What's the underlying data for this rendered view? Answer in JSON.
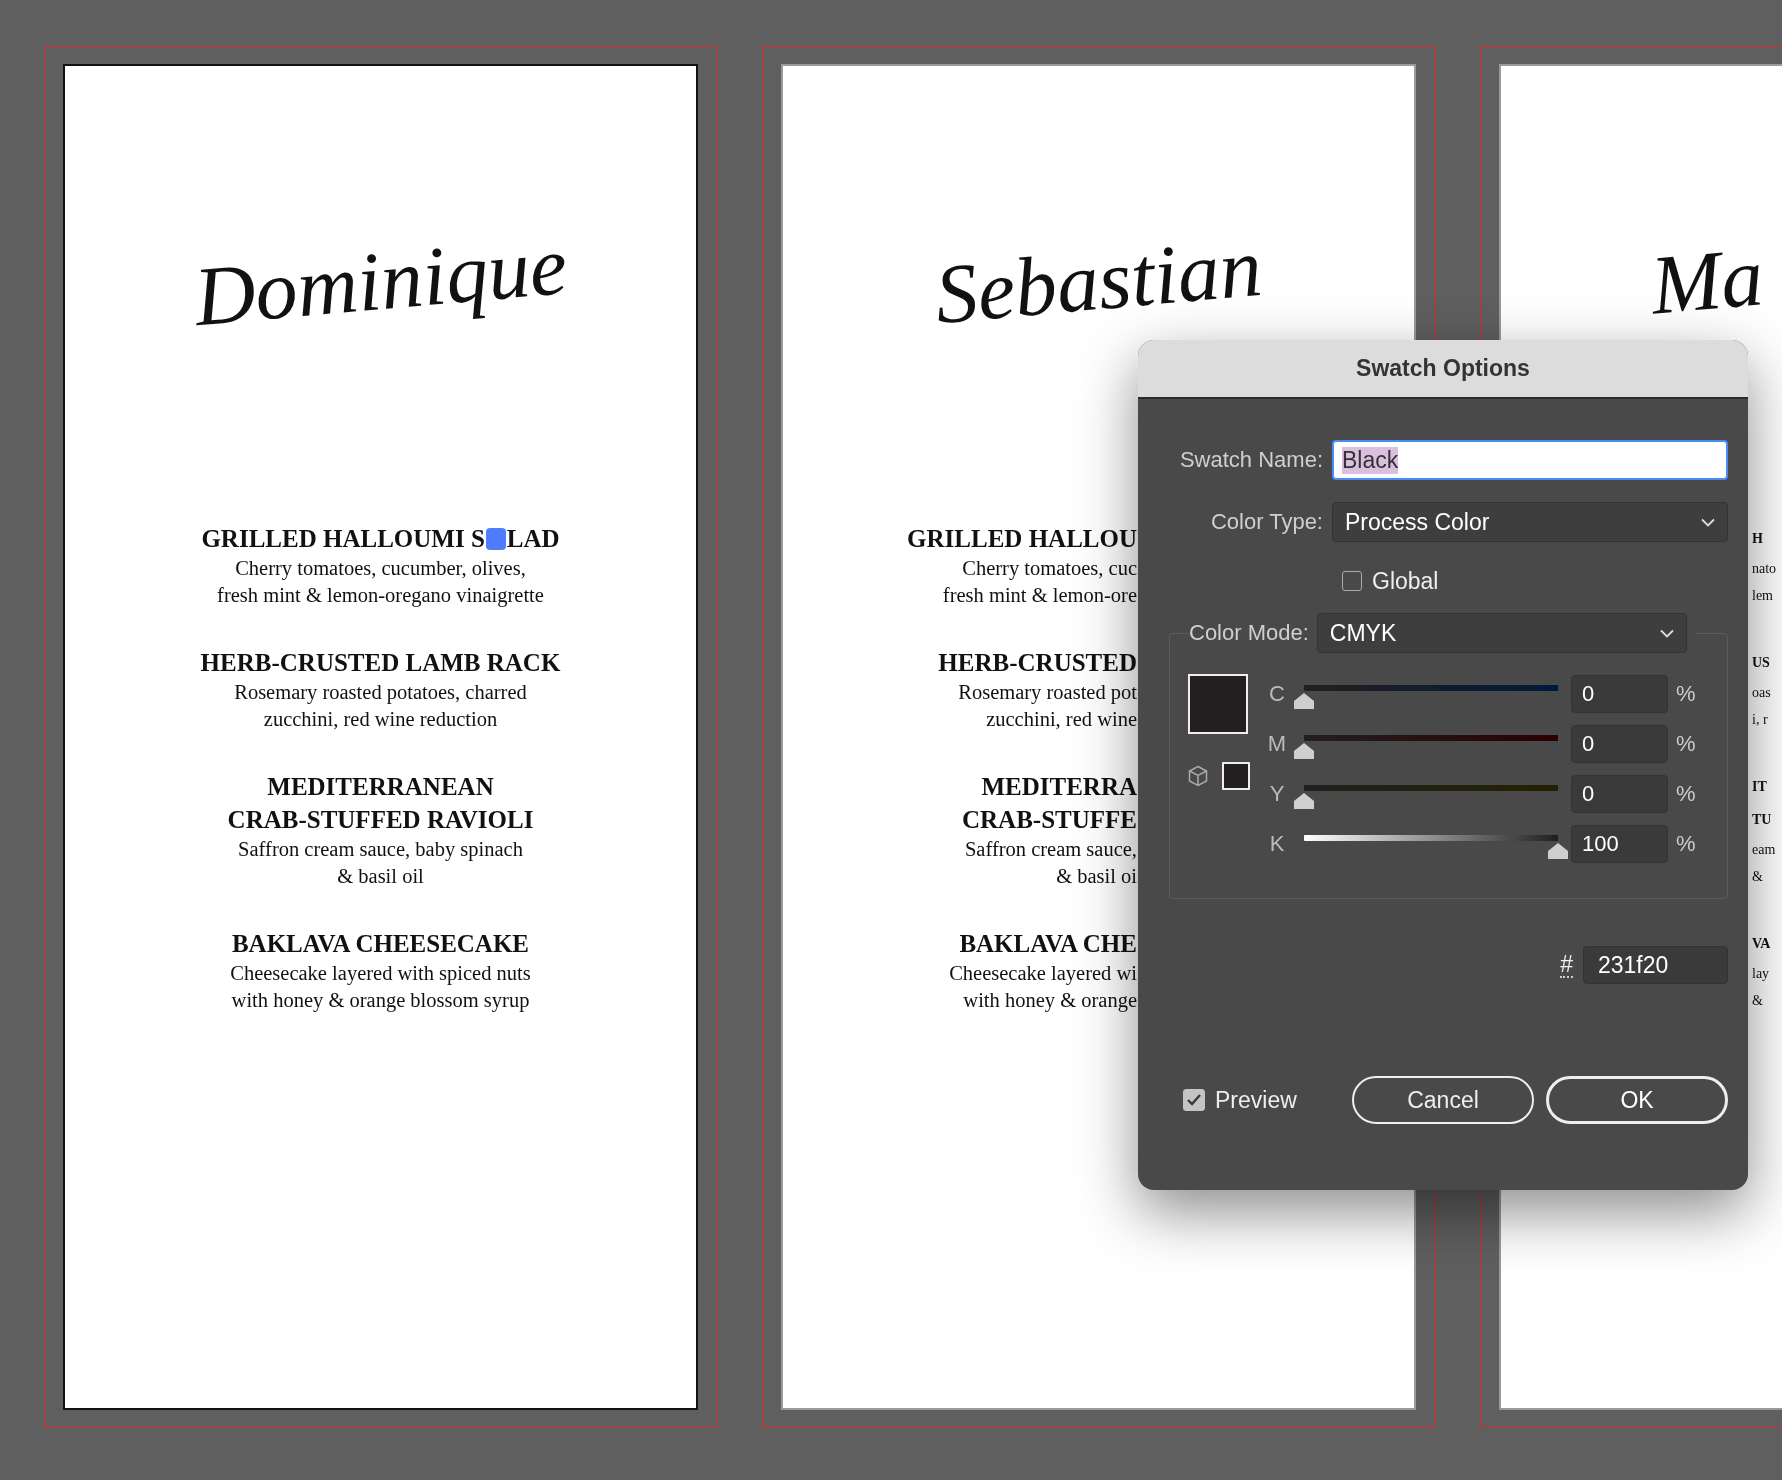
{
  "canvas": {
    "cards": [
      {
        "kind": "full",
        "selected": true,
        "title": "Dominique",
        "items": [
          {
            "heading": [
              "GRILLED HALLOUMI S",
              "LAD"
            ],
            "description": [
              "Cherry tomatoes, cucumber, olives,",
              "fresh mint & lemon-oregano vinaigrette"
            ],
            "text_cursor": true
          },
          {
            "heading": [
              "HERB-CRUSTED LAMB RACK"
            ],
            "description": [
              "Rosemary roasted potatoes, charred",
              "zucchini, red wine reduction"
            ],
            "text_cursor": false
          },
          {
            "heading": [
              "MEDITERRANEAN",
              "CRAB-STUFFED RAVIOLI"
            ],
            "description": [
              "Saffron cream sauce, baby spinach",
              "& basil oil"
            ],
            "text_cursor": false
          },
          {
            "heading": [
              "BAKLAVA CHEESECAKE"
            ],
            "description": [
              "Cheesecake layered with spiced nuts",
              "with honey & orange blossom syrup"
            ],
            "text_cursor": false
          }
        ]
      },
      {
        "kind": "right_hidden",
        "selected": false,
        "title": "Sebastian",
        "items": [
          {
            "heading": [
              "GRILLED HALLOU"
            ],
            "description": [
              "Cherry tomatoes, cuc",
              "fresh mint & lemon-ore"
            ],
            "text_cursor": false
          },
          {
            "heading": [
              "HERB-CRUSTED"
            ],
            "description": [
              "Rosemary roasted pot",
              "zucchini, red wine"
            ],
            "text_cursor": false
          },
          {
            "heading": [
              "MEDITERRA",
              "CRAB-STUFFE"
            ],
            "description": [
              "Saffron cream sauce,",
              "& basil oi"
            ],
            "text_cursor": false
          },
          {
            "heading": [
              "BAKLAVA CHE"
            ],
            "description": [
              "Cheesecake layered wi",
              "with honey & orange"
            ],
            "text_cursor": false
          }
        ]
      },
      {
        "kind": "left_hidden",
        "selected": false,
        "title": "Ma",
        "items": [
          {
            "heading": [
              "H"
            ],
            "description": [
              "nato",
              "lem"
            ],
            "text_cursor": false
          },
          {
            "heading": [
              "US"
            ],
            "description": [
              "oas",
              "i, r"
            ],
            "text_cursor": false
          },
          {
            "heading": [
              "IT",
              "TU"
            ],
            "description": [
              "eam",
              "&"
            ],
            "text_cursor": false
          },
          {
            "heading": [
              "VA"
            ],
            "description": [
              "lay",
              "&"
            ],
            "text_cursor": false
          }
        ]
      }
    ]
  },
  "dialog": {
    "title": "Swatch Options",
    "swatch_name": {
      "label": "Swatch Name:",
      "value": "Black",
      "focused": true,
      "text_selected": true
    },
    "color_type": {
      "label": "Color Type:",
      "value": "Process Color"
    },
    "global": {
      "label": "Global",
      "checked": false
    },
    "color_mode": {
      "label": "Color Mode:",
      "value": "CMYK"
    },
    "swatch": {
      "color": "#231f20"
    },
    "channels": [
      {
        "kind": "ink",
        "name": "C",
        "color": "#001a3a",
        "level": 0,
        "value": "0",
        "unit": "%"
      },
      {
        "kind": "ink",
        "name": "M",
        "color": "#2a0000",
        "level": 0,
        "value": "0",
        "unit": "%"
      },
      {
        "kind": "ink",
        "name": "Y",
        "color": "#222200",
        "level": 0,
        "value": "0",
        "unit": "%"
      },
      {
        "kind": "key",
        "name": "K",
        "color": "#231f20",
        "level": 1,
        "value": "100",
        "unit": "%"
      }
    ],
    "hex": {
      "label": "#",
      "value": "231f20"
    },
    "preview": {
      "label": "Preview",
      "checked": true
    },
    "buttons": [
      {
        "label": "Cancel",
        "default": false
      },
      {
        "label": "OK",
        "default": true
      }
    ]
  }
}
